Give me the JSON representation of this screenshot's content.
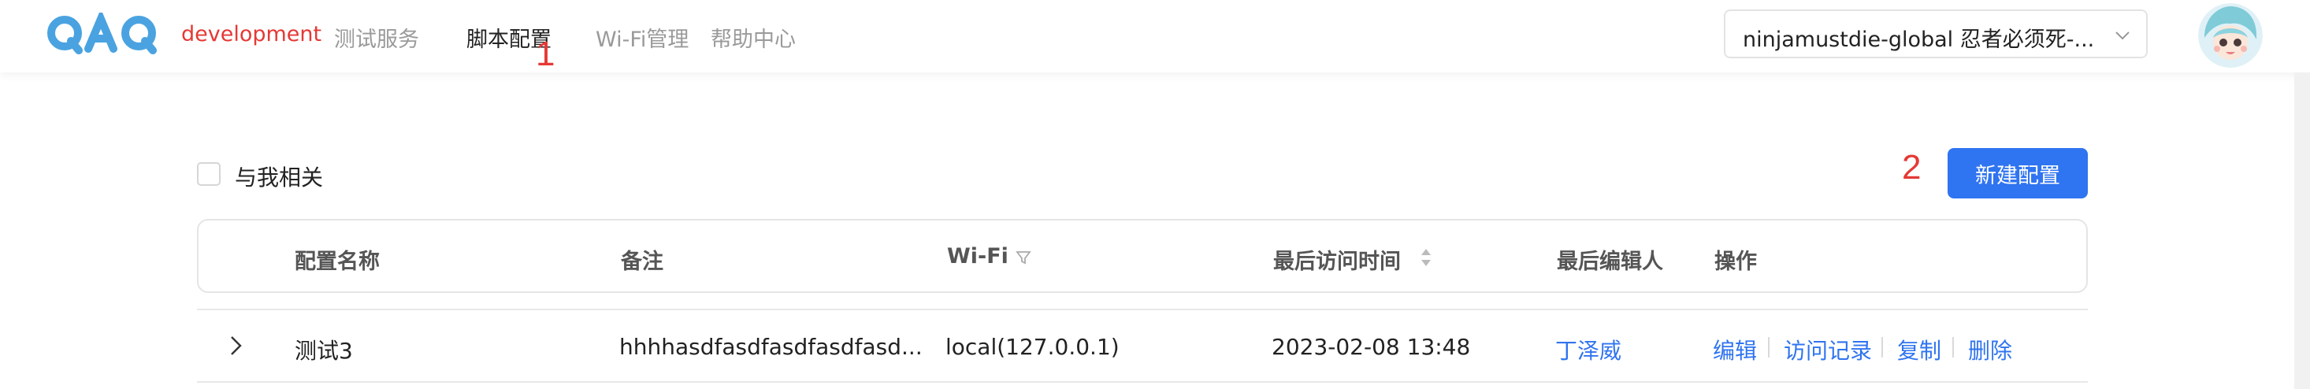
{
  "header": {
    "logo_text": "QAQ",
    "env_label": "development",
    "nav": [
      {
        "label": "测试服务",
        "active": false
      },
      {
        "label": "脚本配置",
        "active": true
      },
      {
        "label": "Wi-Fi管理",
        "active": false
      },
      {
        "label": "帮助中心",
        "active": false
      }
    ],
    "project_select": "ninjamustdie-global 忍者必须死-...",
    "avatar": "avatar-character"
  },
  "annotations": [
    "1",
    "2"
  ],
  "toolbar": {
    "only_mine_label": "与我相关",
    "only_mine_checked": false,
    "new_config_label": "新建配置"
  },
  "table": {
    "columns": [
      "配置名称",
      "备注",
      "Wi-Fi",
      "最后访问时间",
      "最后编辑人",
      "操作"
    ],
    "rows": [
      {
        "name": "测试3",
        "remark": "hhhhasdfasdfasdfasdfasd...",
        "wifi": "local(127.0.0.1)",
        "last_access": "2023-02-08 13:48",
        "last_editor": "丁泽威",
        "actions": [
          "编辑",
          "访问记录",
          "复制",
          "删除"
        ]
      }
    ]
  },
  "colors": {
    "accent": "#2f74f0",
    "env": "#e53935",
    "logo": "#4aa3e0"
  }
}
